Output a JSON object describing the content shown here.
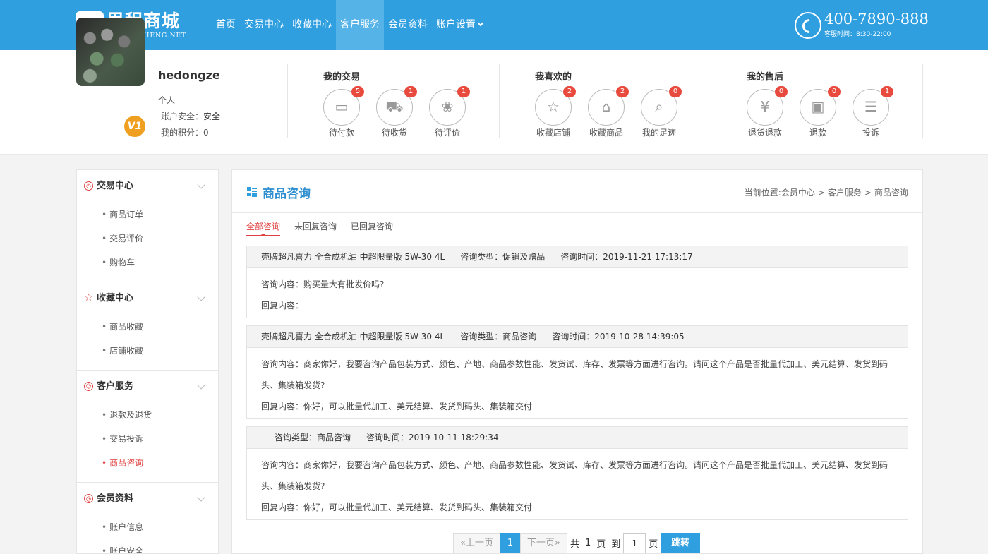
{
  "header": {
    "logo_title": "思程商城",
    "logo_sub": "WWW.SICHENG.NET",
    "nav": [
      "首页",
      "交易中心",
      "收藏中心",
      "客户服务",
      "会员资料",
      "账户设置"
    ],
    "active_nav": "客户服务",
    "phone": "400-7890-888",
    "phone_hours": "客服时间：8:30-22:00"
  },
  "profile": {
    "name": "hedongze",
    "type": "个人",
    "safety_label": "账户安全：",
    "safety_value": "安全",
    "points": "我的积分：0",
    "vip_badge": "V1",
    "groups": [
      {
        "title": "我的交易",
        "items": [
          {
            "label": "待付款",
            "count": "5",
            "icon": "wallet-icon"
          },
          {
            "label": "待收货",
            "count": "1",
            "icon": "truck-icon"
          },
          {
            "label": "待评价",
            "count": "1",
            "icon": "flower-icon"
          }
        ]
      },
      {
        "title": "我喜欢的",
        "items": [
          {
            "label": "收藏店铺",
            "count": "2",
            "icon": "star-icon"
          },
          {
            "label": "收藏商品",
            "count": "2",
            "icon": "store-icon"
          },
          {
            "label": "我的足迹",
            "count": "0",
            "icon": "footprint-icon"
          }
        ]
      },
      {
        "title": "我的售后",
        "items": [
          {
            "label": "退货退款",
            "count": "0",
            "icon": "refund-icon"
          },
          {
            "label": "退款",
            "count": "0",
            "icon": "box-icon"
          },
          {
            "label": "投诉",
            "count": "1",
            "icon": "complaint-icon"
          }
        ]
      }
    ]
  },
  "sidebar": {
    "sections": [
      {
        "title": "交易中心",
        "items": [
          "商品订单",
          "交易评价",
          "购物车"
        ]
      },
      {
        "title": "收藏中心",
        "items": [
          "商品收藏",
          "店铺收藏"
        ]
      },
      {
        "title": "客户服务",
        "items": [
          "退款及退货",
          "交易投诉",
          "商品咨询"
        ]
      },
      {
        "title": "会员资料",
        "items": [
          "账户信息",
          "账户安全"
        ]
      }
    ],
    "active_item": "商品咨询"
  },
  "main": {
    "title": "商品咨询",
    "breadcrumb": {
      "prefix": "当前位置:",
      "items": [
        "会员中心",
        "客户服务",
        "商品咨询"
      ],
      "sep": ">"
    },
    "tabs": [
      "全部咨询",
      "未回复咨询",
      "已回复咨询"
    ],
    "active_tab": "全部咨询",
    "consultations": [
      {
        "product": "壳牌超凡喜力 全合成机油 中超限量版 5W-30 4L",
        "type": "咨询类型：促销及赠品",
        "time": "咨询时间：2019-11-21 17:13:17",
        "content": "咨询内容：购买量大有批发价吗?",
        "reply": "回复内容："
      },
      {
        "product": "壳牌超凡喜力 全合成机油 中超限量版 5W-30 4L",
        "type": "咨询类型：商品咨询",
        "time": "咨询时间：2019-10-28 14:39:05",
        "content": "咨询内容：商家你好，我要咨询产品包装方式、颜色、产地、商品参数性能、发货试、库存、发票等方面进行咨询。请问这个产品是否批量代加工、美元结算、发货到码头、集装箱发货?",
        "reply": "回复内容：你好，可以批量代加工、美元结算、发货到码头、集装箱交付"
      },
      {
        "product": "",
        "type": "咨询类型：商品咨询",
        "time": "咨询时间：2019-10-11 18:29:34",
        "content": "咨询内容：商家你好，我要咨询产品包装方式、颜色、产地、商品参数性能、发货试、库存、发票等方面进行咨询。请问这个产品是否批量代加工、美元结算、发货到码头、集装箱发货?",
        "reply": "回复内容：你好，可以批量代加工、美元结算、发货到码头、集装箱交付"
      }
    ],
    "pager": {
      "prev": "«上一页",
      "current": "1",
      "next": "下一页»",
      "total_prefix": "共",
      "total": "1",
      "total_suffix": "页",
      "goto_prefix": "到",
      "goto_value": "1",
      "goto_suffix": "页",
      "go": "跳转"
    }
  }
}
